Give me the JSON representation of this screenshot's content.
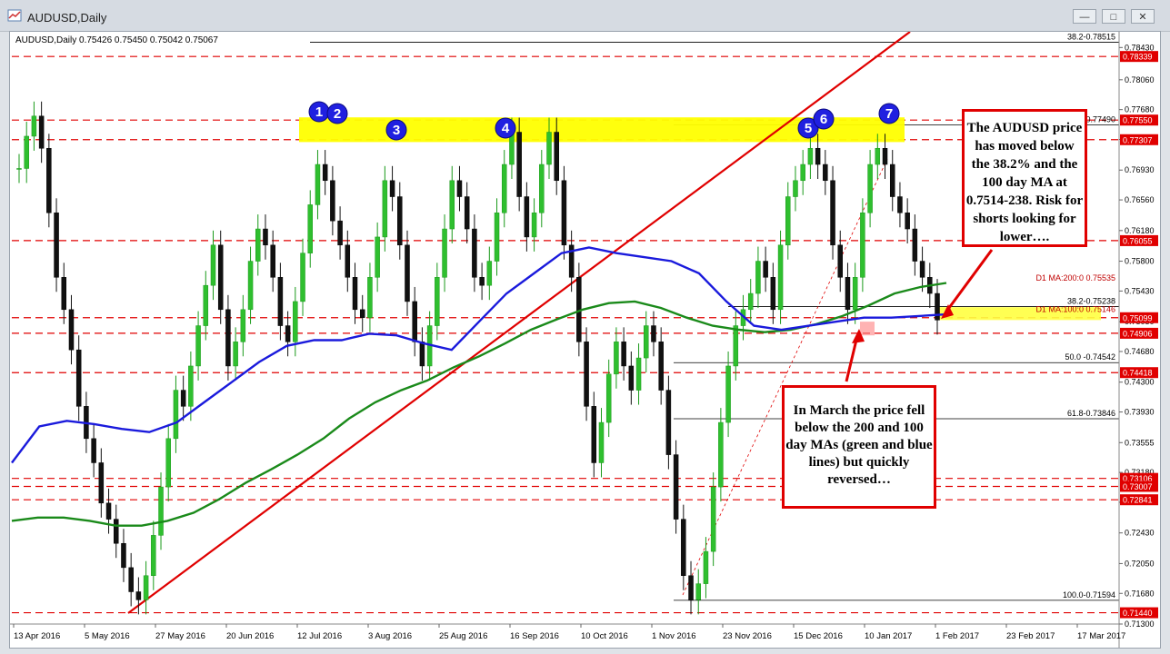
{
  "window": {
    "title": "AUDUSD,Daily",
    "min_label": "—",
    "max_label": "□",
    "close_label": "✕"
  },
  "chart_header": "AUDUSD,Daily  0.75426 0.75450 0.75042 0.75067",
  "chart_data": {
    "type": "candlestick",
    "symbol": "AUDUSD",
    "timeframe": "Daily",
    "ohlc_last": {
      "open": 0.75426,
      "high": 0.7545,
      "low": 0.75042,
      "close": 0.75067
    },
    "ylim": [
      0.713,
      0.786
    ],
    "y_ticks": [
      0.7845,
      0.7805,
      0.7768,
      0.7731,
      0.7693,
      0.7656,
      0.7618,
      0.758,
      0.7543,
      0.7505,
      0.7468,
      0.743,
      0.7393,
      0.7355,
      0.7318,
      0.7281,
      0.7243,
      0.7205,
      0.7168,
      0.713
    ],
    "y_tick_labels": [
      "0.78430",
      "0.78060",
      "0.77680",
      "0.77305",
      "0.76930",
      "0.76560",
      "0.76180",
      "0.75800",
      "0.75430",
      "0.75050",
      "0.74680",
      "0.74300",
      "0.73930",
      "0.73555",
      "0.73180",
      "0.72805",
      "0.72430",
      "0.72050",
      "0.71680",
      "0.71300"
    ],
    "x_labels": [
      "13 Apr 2016",
      "5 May 2016",
      "27 May 2016",
      "20 Jun 2016",
      "12 Jul 2016",
      "3 Aug 2016",
      "25 Aug 2016",
      "16 Sep 2016",
      "10 Oct 2016",
      "1 Nov 2016",
      "23 Nov 2016",
      "15 Dec 2016",
      "10 Jan 2017",
      "1 Feb 2017",
      "23 Feb 2017",
      "17 Mar 2017"
    ],
    "closes": [
      0.7695,
      0.7735,
      0.776,
      0.772,
      0.764,
      0.756,
      0.752,
      0.747,
      0.74,
      0.736,
      0.733,
      0.728,
      0.726,
      0.723,
      0.72,
      0.717,
      0.716,
      0.719,
      0.724,
      0.73,
      0.736,
      0.742,
      0.74,
      0.745,
      0.75,
      0.755,
      0.76,
      0.752,
      0.745,
      0.748,
      0.752,
      0.758,
      0.762,
      0.76,
      0.756,
      0.75,
      0.748,
      0.753,
      0.759,
      0.765,
      0.77,
      0.768,
      0.763,
      0.76,
      0.756,
      0.752,
      0.751,
      0.756,
      0.761,
      0.768,
      0.766,
      0.76,
      0.753,
      0.748,
      0.745,
      0.75,
      0.756,
      0.762,
      0.768,
      0.766,
      0.762,
      0.756,
      0.755,
      0.758,
      0.764,
      0.77,
      0.774,
      0.766,
      0.761,
      0.764,
      0.77,
      0.774,
      0.768,
      0.76,
      0.756,
      0.748,
      0.74,
      0.733,
      0.738,
      0.744,
      0.748,
      0.745,
      0.742,
      0.746,
      0.75,
      0.748,
      0.742,
      0.734,
      0.726,
      0.719,
      0.716,
      0.718,
      0.722,
      0.73,
      0.738,
      0.745,
      0.75,
      0.752,
      0.754,
      0.758,
      0.756,
      0.752,
      0.76,
      0.766,
      0.768,
      0.77,
      0.772,
      0.77,
      0.768,
      0.76,
      0.756,
      0.752,
      0.756,
      0.764,
      0.77,
      0.772,
      0.77,
      0.766,
      0.764,
      0.762,
      0.758,
      0.756,
      0.754,
      0.7507
    ],
    "series": [
      {
        "name": "D1 MA:200:0",
        "color": "#1a8a1a",
        "values": [
          0.7258,
          0.7262,
          0.7262,
          0.7258,
          0.7252,
          0.7252,
          0.7258,
          0.7268,
          0.7285,
          0.7305,
          0.7322,
          0.734,
          0.736,
          0.7385,
          0.7405,
          0.742,
          0.7432,
          0.7448,
          0.7462,
          0.7478,
          0.7495,
          0.7508,
          0.752,
          0.7528,
          0.753,
          0.7522,
          0.751,
          0.75,
          0.7495,
          0.7492,
          0.7495,
          0.7502,
          0.7512,
          0.7525,
          0.754,
          0.7548,
          0.7553
        ]
      },
      {
        "name": "D1 MA:100:0",
        "color": "#1a1adc",
        "values": [
          0.733,
          0.7375,
          0.7382,
          0.7378,
          0.7372,
          0.7368,
          0.738,
          0.7405,
          0.743,
          0.7455,
          0.7475,
          0.7482,
          0.7482,
          0.749,
          0.7488,
          0.7478,
          0.747,
          0.7505,
          0.754,
          0.7565,
          0.759,
          0.7597,
          0.759,
          0.7585,
          0.758,
          0.7565,
          0.753,
          0.75,
          0.7495,
          0.75,
          0.7505,
          0.751,
          0.751,
          0.7512,
          0.7514
        ]
      }
    ],
    "horizontal_levels": [
      {
        "label": "0.78339",
        "value": 0.78339,
        "color": "#e00000"
      },
      {
        "label": "0.77550",
        "value": 0.7755,
        "color": "#e00000"
      },
      {
        "label": "0.77307",
        "value": 0.77307,
        "color": "#e00000"
      },
      {
        "label": "0.76055",
        "value": 0.76055,
        "color": "#e00000"
      },
      {
        "label": "0.75099",
        "value": 0.75099,
        "color": "#e00000"
      },
      {
        "label": "0.74906",
        "value": 0.74906,
        "color": "#e00000"
      },
      {
        "label": "0.74418",
        "value": 0.74418,
        "color": "#e00000"
      },
      {
        "label": "0.73106",
        "value": 0.73106,
        "color": "#e00000"
      },
      {
        "label": "0.73007",
        "value": 0.73007,
        "color": "#e00000"
      },
      {
        "label": "0.72841",
        "value": 0.72841,
        "color": "#e00000"
      },
      {
        "label": "0.71440",
        "value": 0.7144,
        "color": "#e00000"
      }
    ],
    "fib_levels": [
      {
        "label": "38.2-0.78515",
        "value": 0.78515
      },
      {
        "label": "-0.77490",
        "value": 0.7749
      },
      {
        "label": "38.2-0.75238",
        "value": 0.75238
      },
      {
        "label": "50.0 -0.74542",
        "value": 0.74542
      },
      {
        "label": "61.8-0.73846",
        "value": 0.73846
      },
      {
        "label": "100.0-0.71594",
        "value": 0.71594
      }
    ],
    "ma_labels": [
      "D1 MA:200:0 0.75535",
      "D1 MA:100:0 0.75146"
    ],
    "resistance_zone": [
      0.773,
      0.7755
    ],
    "markers": [
      "1",
      "2",
      "3",
      "4",
      "5",
      "6",
      "7"
    ]
  },
  "annotations": {
    "box1": "The AUDUSD price has moved below the 38.2% and the 100 day MA at 0.7514-238. Risk for shorts looking for lower….",
    "box2": "In March the price fell below the 200 and 100 day MAs (green and blue lines) but quickly reversed…"
  }
}
